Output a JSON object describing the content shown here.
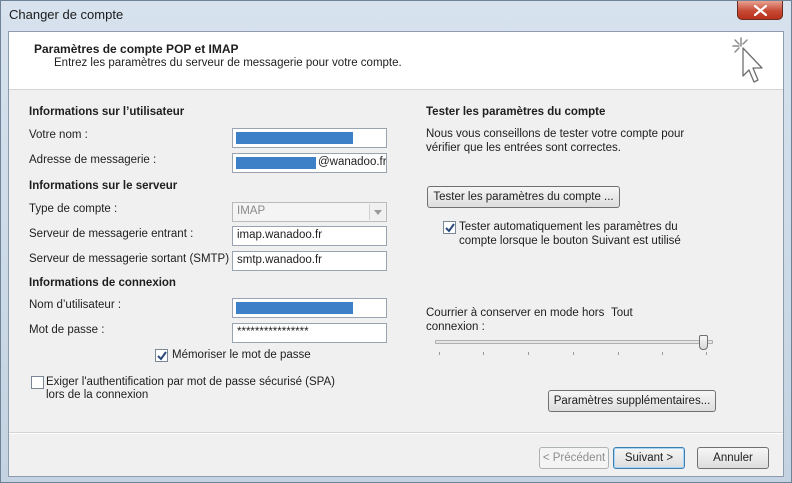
{
  "window": {
    "title": "Changer de compte"
  },
  "header": {
    "title": "Paramètres de compte POP et IMAP",
    "subtitle": "Entrez les paramètres du serveur de messagerie pour votre compte."
  },
  "user_info": {
    "section_title": "Informations sur l’utilisateur",
    "name_label": "Votre nom :",
    "email_label": "Adresse de messagerie :",
    "email_domain_suffix": "@wanadoo.fr"
  },
  "server_info": {
    "section_title": "Informations sur le serveur",
    "account_type_label": "Type de compte :",
    "account_type_value": "IMAP",
    "incoming_label": "Serveur de messagerie entrant :",
    "incoming_value": "imap.wanadoo.fr",
    "outgoing_label": "Serveur de messagerie sortant (SMTP) :",
    "outgoing_value": "smtp.wanadoo.fr"
  },
  "login_info": {
    "section_title": "Informations de connexion",
    "username_label": "Nom d’utilisateur :",
    "password_label": "Mot de passe :",
    "password_value": "****************",
    "remember_password_label": "Mémoriser le mot de passe",
    "remember_password_checked": true,
    "spa_label_line1": "Exiger l'authentification par mot de passe sécurisé (SPA)",
    "spa_label_line2": "lors de la connexion",
    "spa_checked": false
  },
  "test_settings": {
    "section_title": "Tester les paramètres du compte",
    "description_line1": "Nous vous conseillons de tester votre compte pour",
    "description_line2": "vérifier que les entrées sont correctes.",
    "test_button_label": "Tester les paramètres du compte ...",
    "auto_test_label_line1": "Tester automatiquement les paramètres du",
    "auto_test_label_line2": "compte lorsque le bouton Suivant est utilisé",
    "auto_test_checked": true
  },
  "offline_mail": {
    "label_line1": "Courrier à conserver en mode hors",
    "label_line2": "connexion :",
    "value_label": "Tout",
    "slider_fraction": 1.0
  },
  "buttons": {
    "more_settings": "Paramètres supplémentaires...",
    "previous": "< Précédent",
    "next": "Suivant >",
    "cancel": "Annuler"
  },
  "colors": {
    "mask": "#3d80c8",
    "accent": "#3c7fb1"
  }
}
